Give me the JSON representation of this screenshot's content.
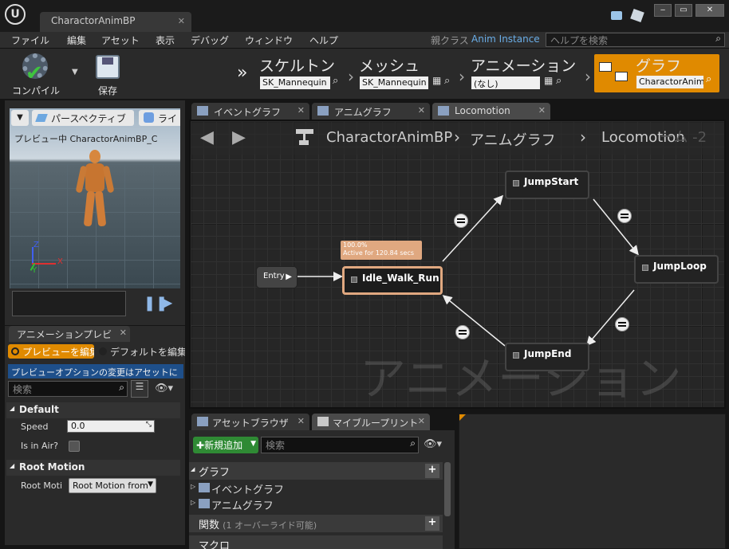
{
  "window": {
    "doc_tab": "CharactorAnimBP",
    "controls": [
      "‒",
      "▭",
      "✕"
    ]
  },
  "menu": {
    "items": [
      "ファイル",
      "編集",
      "アセット",
      "表示",
      "デバッグ",
      "ウィンドウ",
      "ヘルプ"
    ],
    "parent_class_label": "親クラス",
    "parent_class_value": "Anim Instance",
    "help_search_placeholder": "ヘルプを検索"
  },
  "toolbar": {
    "compile_label": "コンパイル",
    "save_label": "保存",
    "modes": [
      {
        "title": "スケルトン",
        "value": "SK_Mannequin"
      },
      {
        "title": "メッシュ",
        "value": "SK_Mannequin"
      },
      {
        "title": "アニメーション",
        "value": "(なし)"
      },
      {
        "title": "グラフ",
        "value": "CharactorAnim"
      }
    ],
    "accent": "#e08a00"
  },
  "viewport": {
    "view_button": "パースペクティブ",
    "lit_button": "ライ",
    "preview_text": "プレビュー中 CharactorAnimBP_C",
    "axis_z": "Z",
    "axis_y": "Y",
    "axis_x": "X"
  },
  "preview_panel": {
    "tab": "アニメーションプレビ",
    "radio_edit": "プレビューを編集",
    "radio_default": "デフォルトを編集",
    "info_banner": "プレビューオプションの変更はアセットに",
    "search_placeholder": "検索",
    "section_default": "Default",
    "speed_label": "Speed",
    "speed_value": "0.0",
    "in_air_label": "Is in Air?",
    "section_root_motion": "Root Motion",
    "root_motion_label": "Root Motio",
    "root_motion_value": "Root Motion from"
  },
  "graph_tabs": [
    "イベントグラフ",
    "アニムグラフ",
    "Locomotion"
  ],
  "graph": {
    "breadcrumb": [
      "CharactorAnimBP",
      "アニムグラフ",
      "Locomotion"
    ],
    "watermark": "アニメーション",
    "zoom_label": "ーム -2",
    "entry": "Entry",
    "active_pct": "100.0%",
    "active_time": "Active for 120.84 secs",
    "nodes": {
      "idle": "Idle_Walk_Run",
      "jump_start": "JumpStart",
      "jump_loop": "JumpLoop",
      "jump_end": "JumpEnd"
    },
    "active_color": "#e0a880"
  },
  "bottom_tabs": [
    "アセットブラウザ",
    "マイブループリント"
  ],
  "my_blueprint": {
    "add_new": "新規追加",
    "search_placeholder": "検索",
    "graph_section": "グラフ",
    "graph_items": [
      "イベントグラフ",
      "アニムグラフ"
    ],
    "functions_label": "関数",
    "functions_count": "(1 オーバーライド可能)",
    "macros_label": "マクロ"
  }
}
